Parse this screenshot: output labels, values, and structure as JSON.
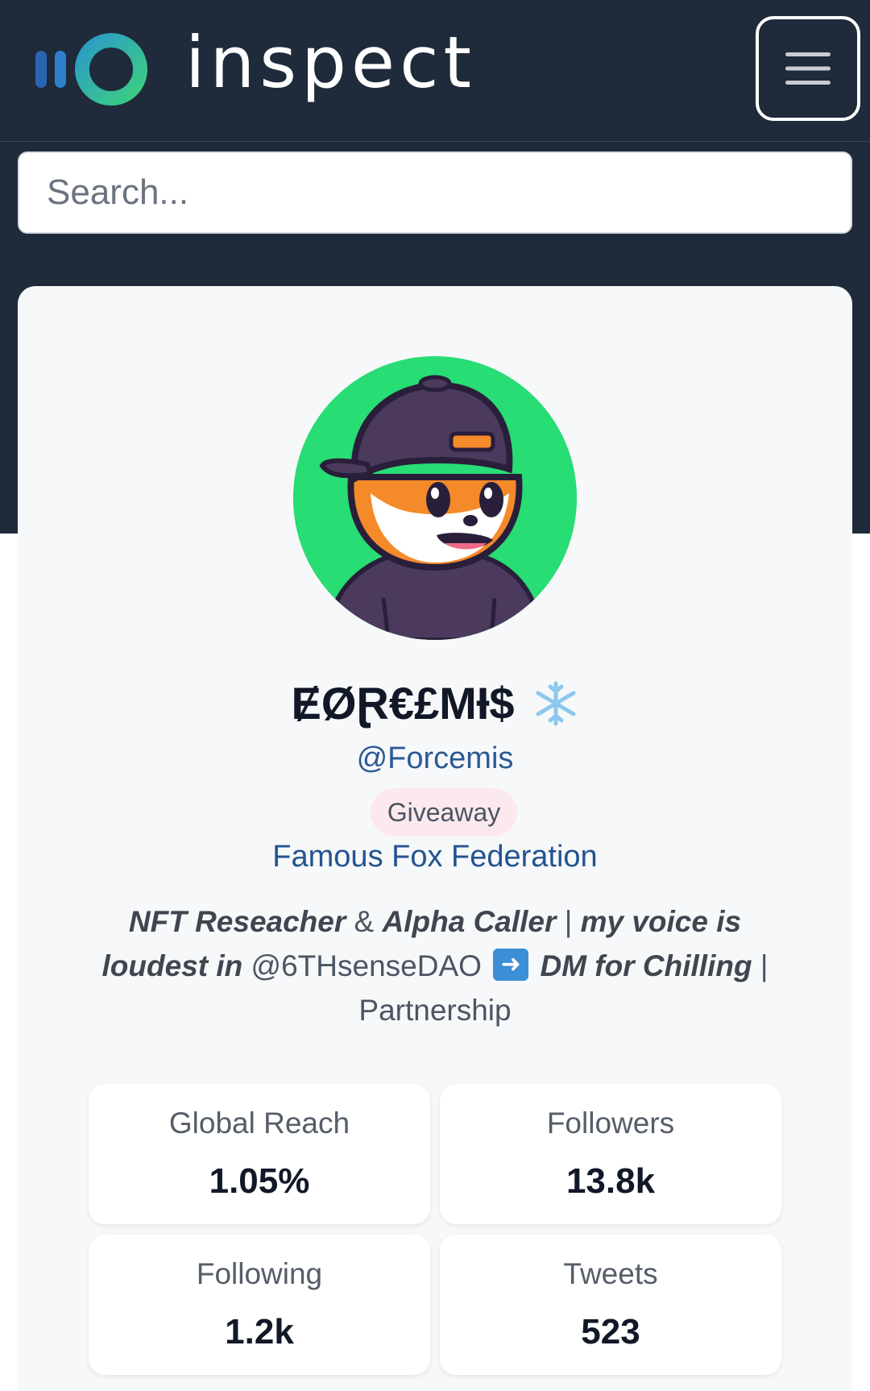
{
  "header": {
    "brand": "inspect",
    "menu_icon": "hamburger-icon"
  },
  "search": {
    "placeholder": "Search...",
    "value": ""
  },
  "profile": {
    "avatar_icon": "fox-avatar",
    "display_name": "ɆØⱤ€£MƗ$",
    "name_emoji": "snowflake-icon",
    "handle": "@Forcemis",
    "badge": "Giveaway",
    "community": "Famous Fox Federation",
    "bio": {
      "p1": "NFT Reseacher",
      "p2": " & ",
      "p3": "Alpha Caller",
      "p4": " | ",
      "p5": "my voice is loudest in",
      "p6": " @6THsenseDAO ",
      "p7": "DM for Chilling",
      "p8": " | Partnership"
    }
  },
  "stats": [
    {
      "label": "Global Reach",
      "value": "1.05%"
    },
    {
      "label": "Followers",
      "value": "13.8k"
    },
    {
      "label": "Following",
      "value": "1.2k"
    },
    {
      "label": "Tweets",
      "value": "523"
    }
  ],
  "colors": {
    "header_bg": "#1f2a3a",
    "accent_link": "#2b5a94",
    "avatar_bg": "#27dd74",
    "badge_bg": "#fbe9ee"
  }
}
